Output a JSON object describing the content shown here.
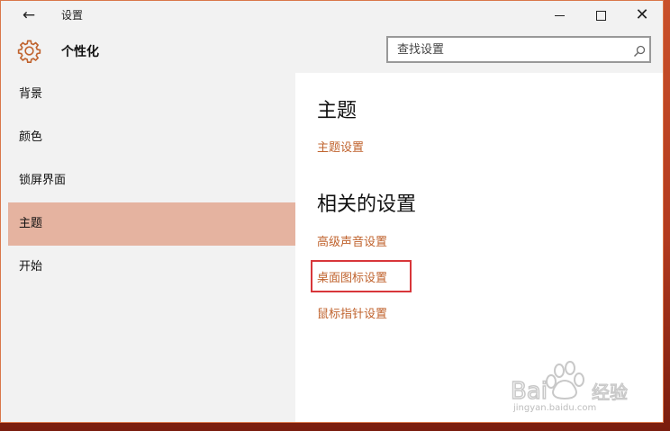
{
  "titlebar": {
    "title": "设置",
    "back_icon": "←",
    "close_icon": "✕"
  },
  "header": {
    "title": "个性化",
    "search_placeholder": "查找设置"
  },
  "sidebar": {
    "items": [
      {
        "label": "背景",
        "selected": false
      },
      {
        "label": "颜色",
        "selected": false
      },
      {
        "label": "锁屏界面",
        "selected": false
      },
      {
        "label": "主题",
        "selected": true
      },
      {
        "label": "开始",
        "selected": false
      }
    ]
  },
  "main": {
    "section1_title": "主题",
    "theme_settings_link": "主题设置",
    "section2_title": "相关的设置",
    "links": [
      "高级声音设置",
      "桌面图标设置",
      "鼠标指针设置"
    ]
  },
  "watermark": {
    "logo_text": "Bai 经验",
    "url_text": "jingyan.baidu.com"
  },
  "colors": {
    "accent": "#c0632e",
    "selected_bg": "#e5b3a0",
    "highlight_border": "#d8363a"
  }
}
